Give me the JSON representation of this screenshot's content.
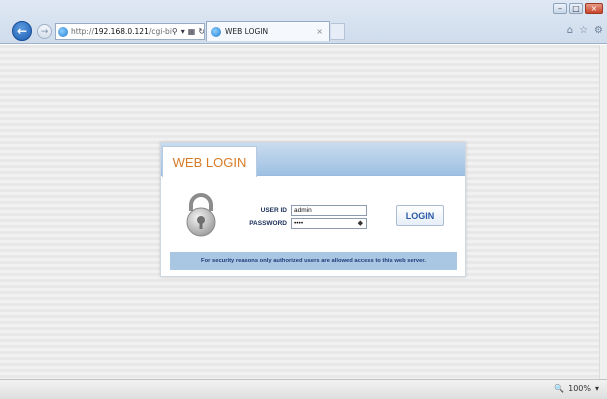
{
  "browser": {
    "address": {
      "scheme": "http://",
      "host": "192.168.0.121",
      "path": "/cgi-bi"
    },
    "tab_title": "WEB LOGIN",
    "tab_close": "×",
    "icons": {
      "back": "back-arrow-icon",
      "forward": "forward-arrow-icon",
      "search": "search-icon",
      "dropdown": "dropdown-icon",
      "compat": "compatibility-view-icon",
      "refresh": "refresh-icon",
      "home": "home-icon",
      "favorites": "star-icon",
      "tools": "gear-icon"
    }
  },
  "status_bar": {
    "zoom": "100%"
  },
  "login": {
    "title": "WEB LOGIN",
    "user_id_label": "USER ID",
    "user_id_value": "admin",
    "password_label": "PASSWORD",
    "password_value": "••••",
    "button_label": "LOGIN",
    "notice": "For security reasons only authorized users are allowed access to this web server."
  },
  "colors": {
    "accent_orange": "#d87b25",
    "header_blue": "#9ec0e2",
    "notice_bg": "#a9c6e2",
    "button_text": "#2a5aa8"
  }
}
